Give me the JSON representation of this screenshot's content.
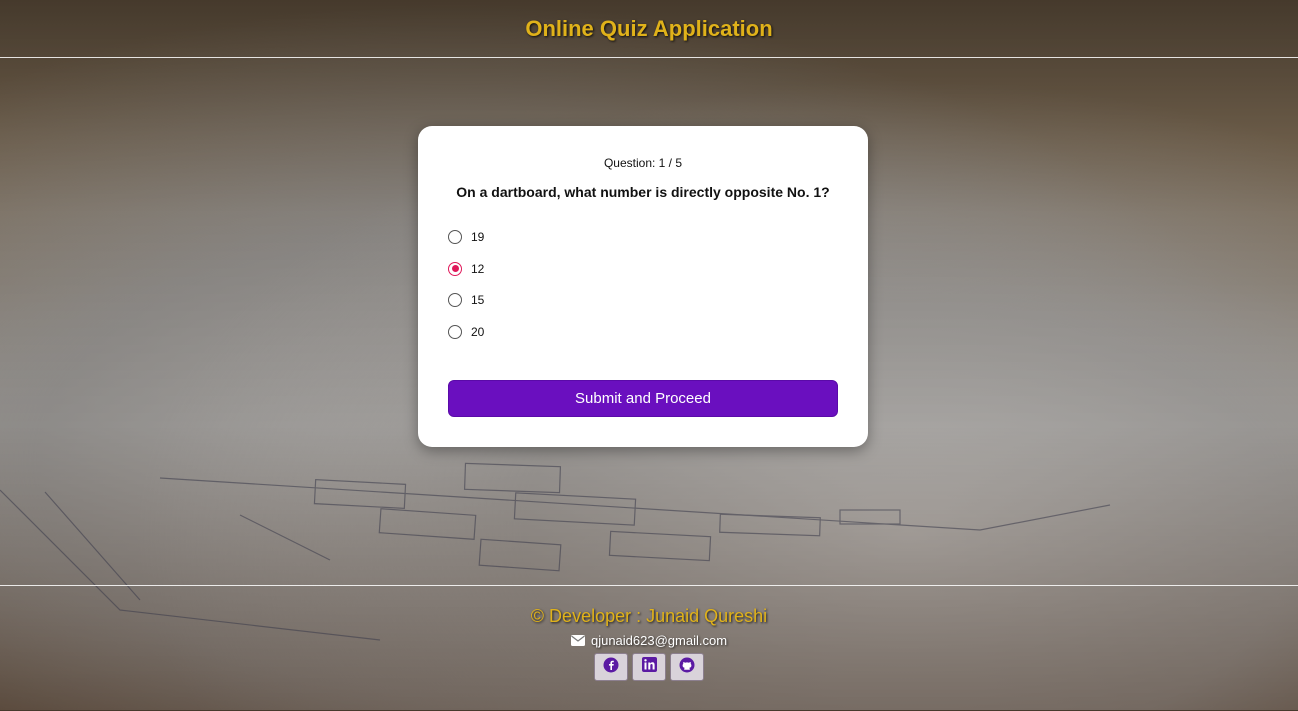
{
  "header": {
    "title": "Online Quiz Application"
  },
  "quiz": {
    "counter": "Question: 1 / 5",
    "question": "On a dartboard, what number is directly opposite No. 1?",
    "options": [
      "19",
      "12",
      "15",
      "20"
    ],
    "selected": "12",
    "submit_label": "Submit and Proceed"
  },
  "footer": {
    "developer": "© Developer : Junaid Qureshi",
    "email": "qjunaid623@gmail.com",
    "socials": [
      "facebook-icon",
      "linkedin-icon",
      "github-icon"
    ]
  },
  "colors": {
    "accent": "#6a0fbf",
    "title": "#e0b21a",
    "radio_selected": "#e0185a"
  }
}
